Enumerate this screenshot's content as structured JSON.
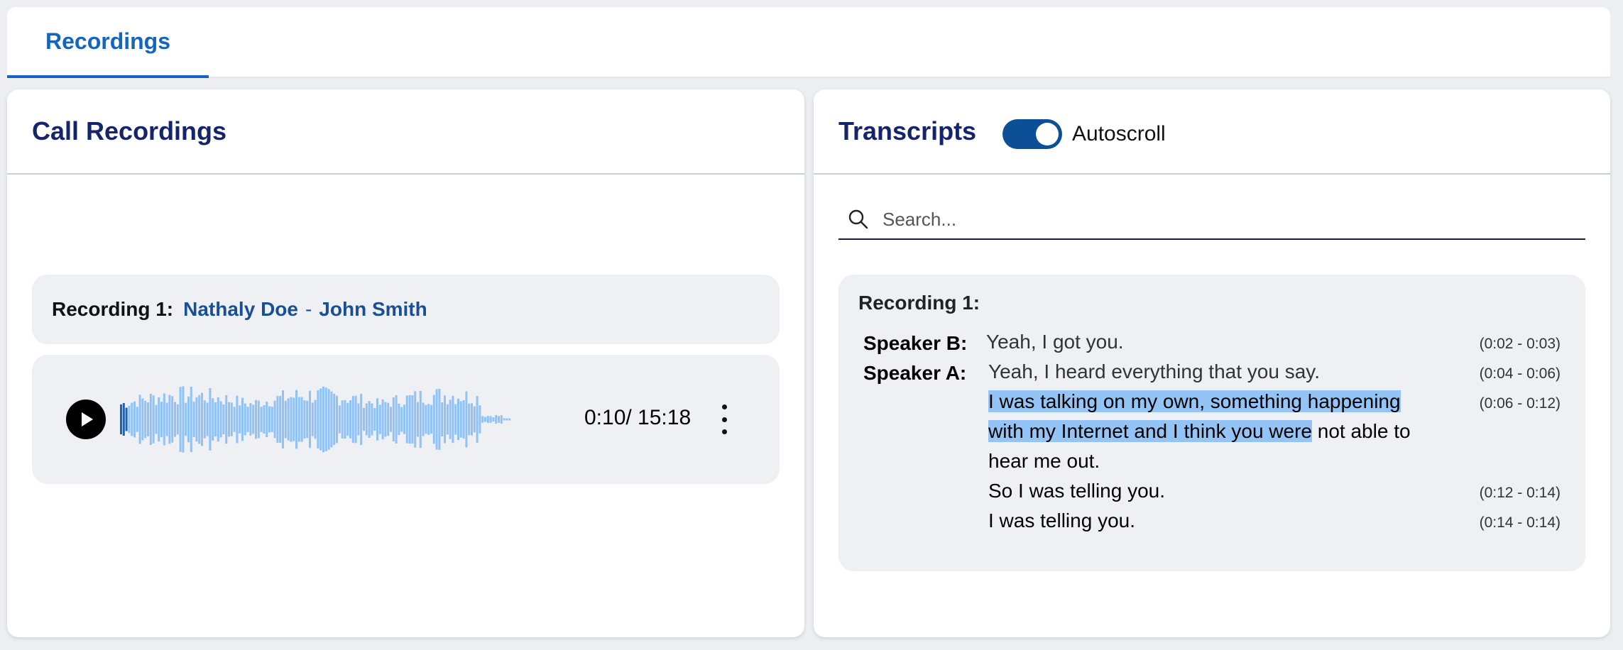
{
  "tabs": [
    {
      "label": "Recordings",
      "active": true
    }
  ],
  "left": {
    "title": "Call Recordings",
    "recording": {
      "label": "Recording 1:",
      "participant_a": "Nathaly Doe",
      "separator": "-",
      "participant_b": "John Smith"
    },
    "player": {
      "play_icon": "play-icon",
      "time_display": "0:10/ 15:18",
      "progress_fraction": 0.011,
      "menu_icon": "more-vertical-icon",
      "wave_color": "#90c2f5",
      "played_color": "#1565c0"
    }
  },
  "right": {
    "title": "Transcripts",
    "autoscroll": {
      "label": "Autoscroll",
      "on": true
    },
    "search": {
      "placeholder": "Search...",
      "value": "",
      "icon": "search-icon"
    },
    "transcript": {
      "title": "Recording 1:",
      "speaker_b": "Speaker B:",
      "speaker_a": "Speaker A:",
      "lines": [
        {
          "text": "Yeah, I got you.",
          "time": "(0:02 - 0:03)"
        },
        {
          "text": "Yeah, I heard everything that you say.",
          "time": "(0:04 - 0:06)"
        },
        {
          "text_hl_1": "I was talking on my own, something happening",
          "text_hl_2": "with my Internet and I think you were",
          "text_rest": " not able to",
          "text_3": "hear me out.",
          "time": "(0:06 - 0:12)"
        },
        {
          "text": "So I was telling you.",
          "time": "(0:12 - 0:14)"
        },
        {
          "text": "I was telling you.",
          "time": "(0:14 - 0:14)"
        }
      ]
    }
  },
  "colors": {
    "accent": "#1565c0",
    "title_navy": "#16256b",
    "highlight": "#93c4f5",
    "toggle": "#0d4f96"
  }
}
